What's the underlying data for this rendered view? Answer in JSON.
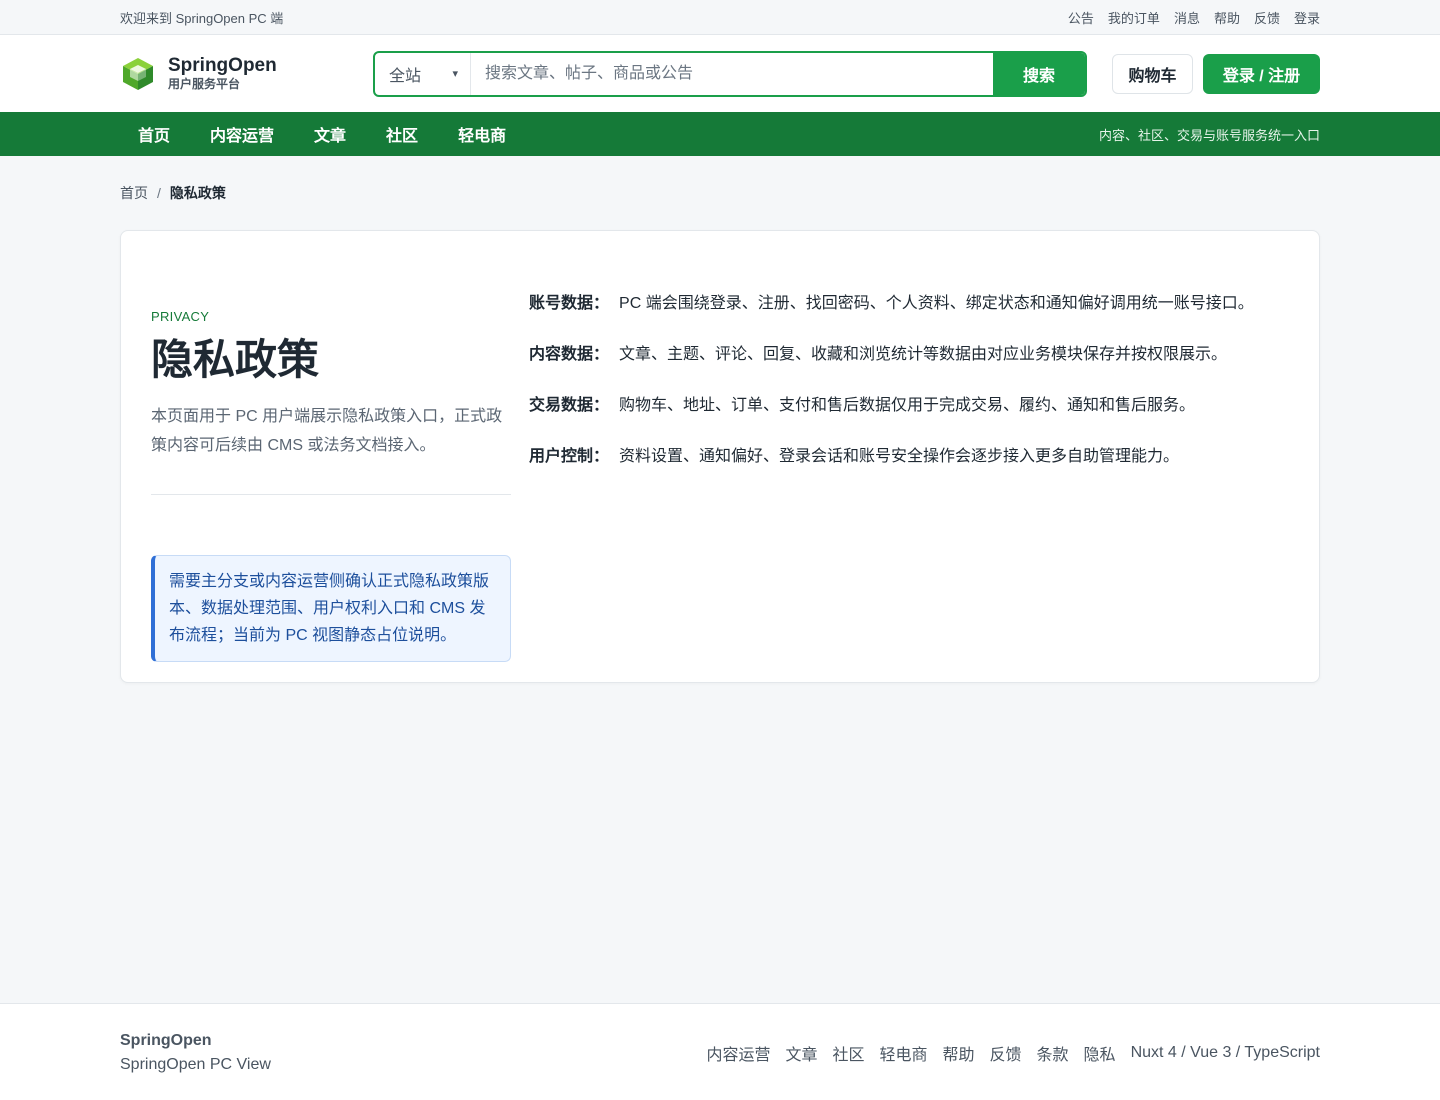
{
  "topbar": {
    "welcome": "欢迎来到 SpringOpen PC 端",
    "links": [
      "公告",
      "我的订单",
      "消息",
      "帮助",
      "反馈",
      "登录"
    ]
  },
  "header": {
    "logo_icon": "cube-logo-icon",
    "brand_name": "SpringOpen",
    "brand_sub": "用户服务平台",
    "search_scope": "全站",
    "search_placeholder": "搜索文章、帖子、商品或公告",
    "search_button": "搜索",
    "cart_button": "购物车",
    "login_button": "登录 / 注册",
    "accent_color": "#1a9f4a"
  },
  "nav": {
    "items": [
      "首页",
      "内容运营",
      "文章",
      "社区",
      "轻电商"
    ],
    "slogan": "内容、社区、交易与账号服务统一入口",
    "background_color": "#157a38"
  },
  "breadcrumb": {
    "home": "首页",
    "separator": "/",
    "current": "隐私政策"
  },
  "content": {
    "eyebrow": "PRIVACY",
    "title": "隐私政策",
    "intro": "本页面用于 PC 用户端展示隐私政策入口，正式政策内容可后续由 CMS 或法务文档接入。",
    "notice": "需要主分支或内容运营侧确认正式隐私政策版本、数据处理范围、用户权利入口和 CMS 发布流程；当前为 PC 视图静态占位说明。",
    "items": [
      {
        "label": "账号数据：",
        "text": "PC 端会围绕登录、注册、找回密码、个人资料、绑定状态和通知偏好调用统一账号接口。"
      },
      {
        "label": "内容数据：",
        "text": "文章、主题、评论、回复、收藏和浏览统计等数据由对应业务模块保存并按权限展示。"
      },
      {
        "label": "交易数据：",
        "text": "购物车、地址、订单、支付和售后数据仅用于完成交易、履约、通知和售后服务。"
      },
      {
        "label": "用户控制：",
        "text": "资料设置、通知偏好、登录会话和账号安全操作会逐步接入更多自助管理能力。"
      }
    ]
  },
  "footer": {
    "brand": "SpringOpen",
    "sub": "SpringOpen PC View",
    "links": [
      "内容运营",
      "文章",
      "社区",
      "轻电商",
      "帮助",
      "反馈",
      "条款",
      "隐私"
    ],
    "tech": "Nuxt 4 / Vue 3 / TypeScript"
  }
}
